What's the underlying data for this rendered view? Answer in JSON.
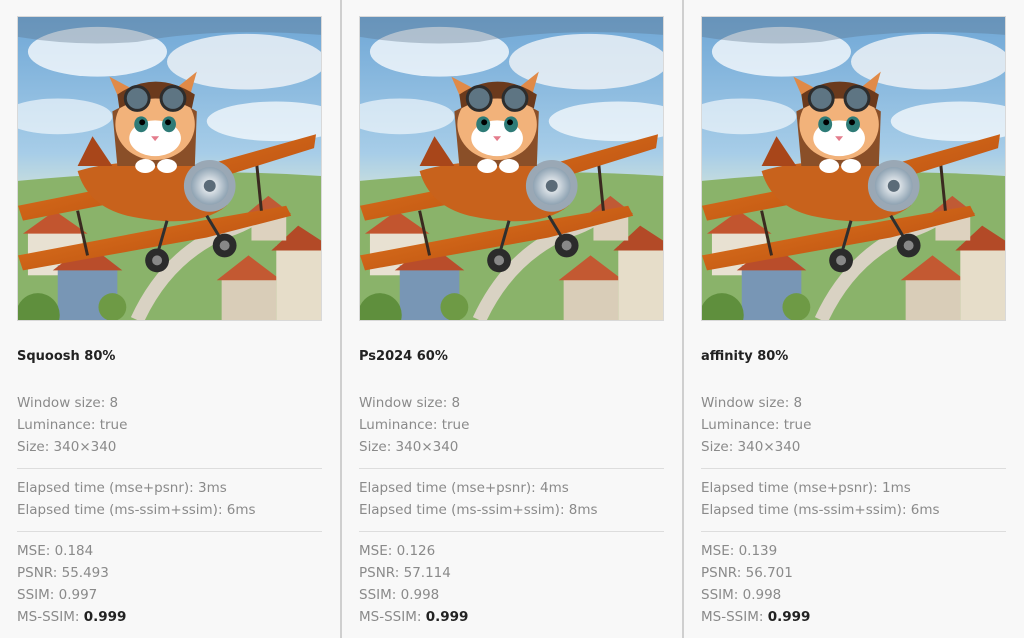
{
  "cards": [
    {
      "title": "Squoosh 80%",
      "window_size": "Window size: 8",
      "luminance": "Luminance: true",
      "size": "Size: 340×340",
      "elapsed_mse_psnr": "Elapsed time (mse+psnr): 3ms",
      "elapsed_ssim": "Elapsed time (ms-ssim+ssim): 6ms",
      "mse": "MSE: 0.184",
      "psnr": "PSNR: 55.493",
      "ssim": "SSIM: 0.997",
      "ms_ssim_label": "MS-SSIM: ",
      "ms_ssim_value": "0.999"
    },
    {
      "title": "Ps2024 60%",
      "window_size": "Window size: 8",
      "luminance": "Luminance: true",
      "size": "Size: 340×340",
      "elapsed_mse_psnr": "Elapsed time (mse+psnr): 4ms",
      "elapsed_ssim": "Elapsed time (ms-ssim+ssim): 8ms",
      "mse": "MSE: 0.126",
      "psnr": "PSNR: 57.114",
      "ssim": "SSIM: 0.998",
      "ms_ssim_label": "MS-SSIM: ",
      "ms_ssim_value": "0.999"
    },
    {
      "title": "affinity 80%",
      "window_size": "Window size: 8",
      "luminance": "Luminance: true",
      "size": "Size: 340×340",
      "elapsed_mse_psnr": "Elapsed time (mse+psnr): 1ms",
      "elapsed_ssim": "Elapsed time (ms-ssim+ssim): 6ms",
      "mse": "MSE: 0.139",
      "psnr": "PSNR: 56.701",
      "ssim": "SSIM: 0.998",
      "ms_ssim_label": "MS-SSIM: ",
      "ms_ssim_value": "0.999"
    }
  ]
}
